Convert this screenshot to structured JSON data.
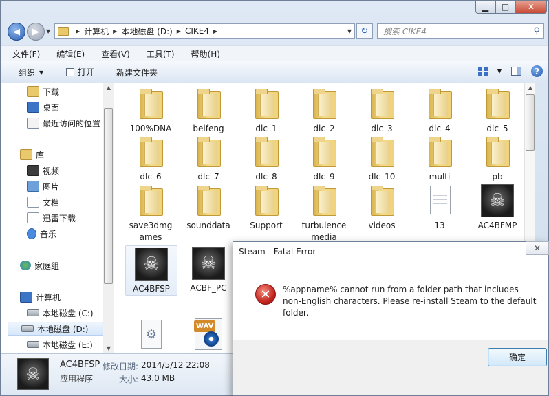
{
  "window": {
    "caption_buttons": {
      "minimize": "▁",
      "maximize": "□",
      "close": "✕"
    }
  },
  "nav": {
    "back_glyph": "◀",
    "forward_glyph": "▶",
    "address": [
      "计算机",
      "本地磁盘 (D:)",
      "CIKE4"
    ],
    "refresh_glyph": "↻",
    "search_placeholder": "搜索 CIKE4",
    "search_glyph": "⚲"
  },
  "menu": [
    "文件(F)",
    "编辑(E)",
    "查看(V)",
    "工具(T)",
    "帮助(H)"
  ],
  "toolbar": {
    "organize": "组织",
    "organize_arrow": "▼",
    "open": "打开",
    "new_folder": "新建文件夹",
    "help": "?"
  },
  "sidebar": {
    "items": [
      "下载",
      "桌面",
      "最近访问的位置",
      "库",
      "视频",
      "图片",
      "文档",
      "迅雷下载",
      "音乐",
      "家庭组",
      "计算机",
      "本地磁盘 (C:)",
      "本地磁盘 (D:)",
      "本地磁盘 (E:)"
    ],
    "selected": "本地磁盘 (D:)"
  },
  "files": [
    {
      "name": "100%DNA",
      "icon": "folder-icon"
    },
    {
      "name": "beifeng",
      "icon": "folder-icon"
    },
    {
      "name": "dlc_1",
      "icon": "folder-icon"
    },
    {
      "name": "dlc_2",
      "icon": "folder-icon"
    },
    {
      "name": "dlc_3",
      "icon": "folder-icon"
    },
    {
      "name": "dlc_4",
      "icon": "folder-icon"
    },
    {
      "name": "dlc_5",
      "icon": "folder-icon"
    },
    {
      "name": "dlc_6",
      "icon": "folder-icon"
    },
    {
      "name": "dlc_7",
      "icon": "folder-icon"
    },
    {
      "name": "dlc_8",
      "icon": "folder-icon"
    },
    {
      "name": "dlc_9",
      "icon": "folder-icon"
    },
    {
      "name": "dlc_10",
      "icon": "folder-icon"
    },
    {
      "name": "multi",
      "icon": "folder-icon"
    },
    {
      "name": "pb",
      "icon": "folder-icon"
    },
    {
      "name": "save3dmg ames",
      "icon": "folder-icon"
    },
    {
      "name": "sounddata",
      "icon": "folder-icon"
    },
    {
      "name": "Support",
      "icon": "folder-icon"
    },
    {
      "name": "turbulence media",
      "icon": "folder-icon"
    },
    {
      "name": "videos",
      "icon": "folder-icon"
    },
    {
      "name": "13",
      "icon": "text-file-icon"
    },
    {
      "name": "AC4BFMP",
      "icon": "assassin-logo-icon"
    },
    {
      "name": "AC4BFSP",
      "icon": "assassin-logo-icon"
    },
    {
      "name": "ACBF_PC",
      "icon": "assassin-logo-icon"
    },
    {
      "name": "",
      "icon": "setup-file-icon"
    },
    {
      "name": "",
      "icon": "wav-file-icon"
    }
  ],
  "files_wav_tag": "WAV",
  "details": {
    "name": "AC4BFSP",
    "type": "应用程序",
    "modified_label": "修改日期:",
    "modified_value": "2014/5/12 22:08",
    "size_label": "大小:",
    "size_value": "43.0 MB"
  },
  "dialog": {
    "title": "Steam - Fatal Error",
    "message": "%appname% cannot run from a folder path that includes non-English characters. Please re-install Steam to the default folder.",
    "ok": "确定",
    "close_glyph": "✕",
    "error_glyph": "✕"
  }
}
